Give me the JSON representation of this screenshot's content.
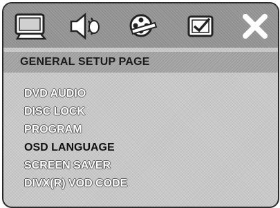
{
  "tabs": [
    {
      "name": "general-setup",
      "icon": "monitor-icon"
    },
    {
      "name": "audio-setup",
      "icon": "speaker-icon"
    },
    {
      "name": "video-setup",
      "icon": "film-reel-icon"
    },
    {
      "name": "preference-setup",
      "icon": "checkbox-icon"
    },
    {
      "name": "exit",
      "icon": "close-icon"
    }
  ],
  "header": {
    "title": "GENERAL SETUP PAGE"
  },
  "menu": {
    "items": [
      {
        "label": "DVD AUDIO"
      },
      {
        "label": "DISC LOCK"
      },
      {
        "label": "PROGRAM"
      },
      {
        "label": "OSD LANGUAGE"
      },
      {
        "label": "SCREEN SAVER"
      },
      {
        "label": "DIVX(R) VOD CODE"
      }
    ],
    "selected": "OSD LANGUAGE"
  },
  "colors": {
    "highlight_text": "#111111",
    "item_text": "#ffffff",
    "bar": "#9a9a9a"
  }
}
